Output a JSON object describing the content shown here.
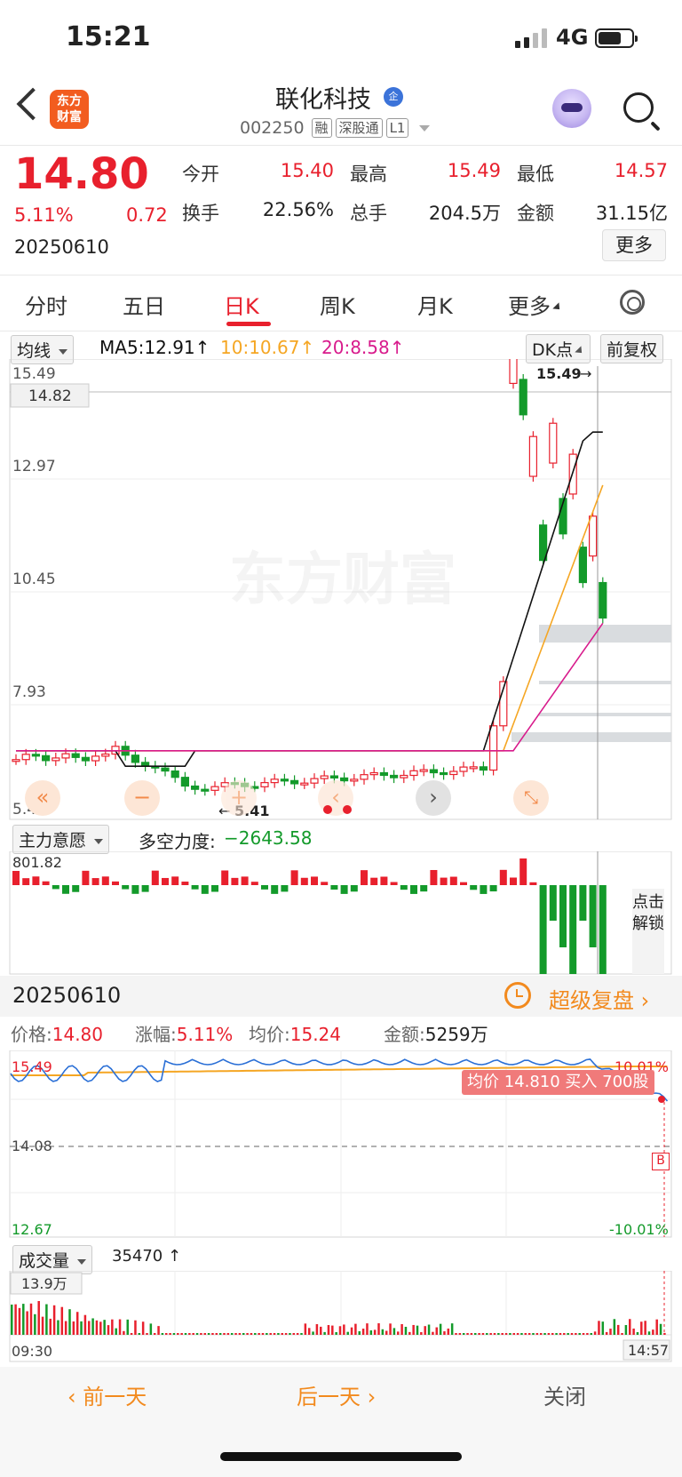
{
  "status_bar": {
    "time": "15:21",
    "network": "4G"
  },
  "header": {
    "logo_line1": "东方",
    "logo_line2": "财富",
    "stock_name": "联化科技",
    "qi_badge": "企",
    "code": "002250",
    "tags": [
      "融",
      "深股通",
      "L1"
    ]
  },
  "quote": {
    "price": "14.80",
    "change_pct": "5.11%",
    "change_amt": "0.72",
    "date": "20250610",
    "fields": [
      {
        "label": "今开",
        "value": "15.40",
        "color": "red"
      },
      {
        "label": "最高",
        "value": "15.49",
        "color": "red"
      },
      {
        "label": "最低",
        "value": "14.57",
        "color": "red"
      },
      {
        "label": "换手",
        "value": "22.56%",
        "color": "black"
      },
      {
        "label": "总手",
        "value": "204.5万",
        "color": "black"
      },
      {
        "label": "金额",
        "value": "31.15亿",
        "color": "black"
      }
    ],
    "more_label": "更多"
  },
  "tabs": [
    "分时",
    "五日",
    "日K",
    "周K",
    "月K",
    "更多"
  ],
  "active_tab": "日K",
  "kline": {
    "indicator_select": "均线",
    "ma5": "MA5:12.91",
    "ma10": "10:10.67",
    "ma20": "20:8.58",
    "dk_label": "DK点",
    "adjust_label": "前复权",
    "y_ticks": [
      "15.49",
      "12.97",
      "10.45",
      "7.93",
      "5.41"
    ],
    "price_tag": "14.82",
    "high_annotation": "15.49",
    "low_annotation": "5.41",
    "watermark": "东方财富",
    "colors": {
      "up": "#e8202d",
      "down": "#139a2a",
      "ma5": "#111111",
      "ma10": "#f5a623",
      "ma20": "#d81b8c"
    }
  },
  "sub_indicator": {
    "select": "主力意愿",
    "label": "多空力度:",
    "value": "−2643.58",
    "top_value": "801.82",
    "unlock_text": "点击解锁"
  },
  "replay": {
    "date": "20250610",
    "super_replay": "超级复盘",
    "price_label": "价格:",
    "price_value": "14.80",
    "chg_label": "涨幅:",
    "chg_value": "5.11%",
    "avg_label": "均价:",
    "avg_value": "15.24",
    "amt_label": "金额:",
    "amt_value": "5259万",
    "intraday_top": "15.49",
    "intraday_top_pct": "10.01%",
    "intraday_mid": "14.08",
    "intraday_bottom": "12.67",
    "intraday_bottom_pct": "-10.01%",
    "trade_tag": "均价 14.810 买入 700股",
    "buy_marker": "B",
    "volume_select": "成交量",
    "volume_value": "35470",
    "volume_max": "13.9万",
    "time_start": "09:30",
    "time_cursor": "14:57"
  },
  "bottom": {
    "prev_day": "前一天",
    "next_day": "后一天",
    "close": "关闭"
  }
}
